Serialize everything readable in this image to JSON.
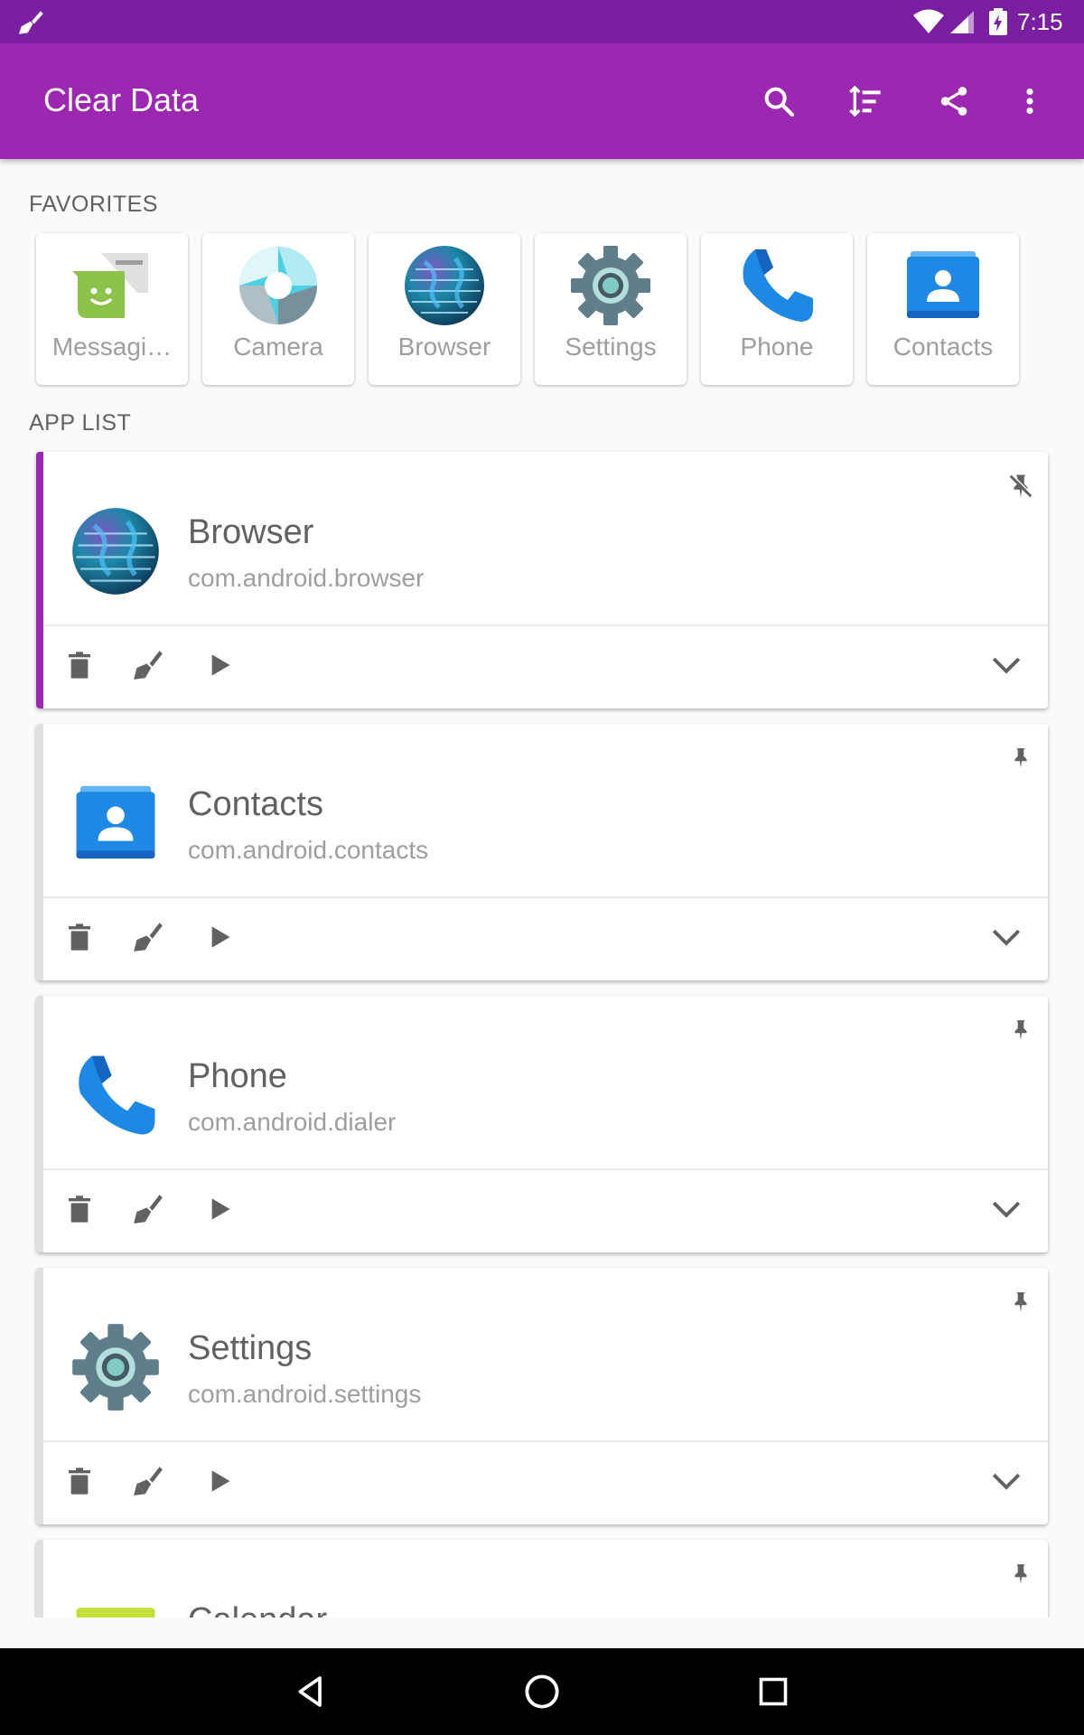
{
  "status_bar": {
    "time": "7:15"
  },
  "app_bar": {
    "title": "Clear Data",
    "icons": [
      "search-icon",
      "sort-icon",
      "share-icon",
      "more-vert-icon"
    ]
  },
  "favorites": {
    "header": "FAVORITES",
    "items": [
      {
        "label": "Messagi…",
        "icon": "messaging-app-icon"
      },
      {
        "label": "Camera",
        "icon": "camera-app-icon"
      },
      {
        "label": "Browser",
        "icon": "browser-app-icon"
      },
      {
        "label": "Settings",
        "icon": "settings-app-icon"
      },
      {
        "label": "Phone",
        "icon": "phone-app-icon"
      },
      {
        "label": "Contacts",
        "icon": "contacts-app-icon"
      }
    ]
  },
  "app_list": {
    "header": "APP LIST",
    "items": [
      {
        "name": "Browser",
        "package": "com.android.browser",
        "pinned": false,
        "active": true
      },
      {
        "name": "Contacts",
        "package": "com.android.contacts",
        "pinned": true,
        "active": false
      },
      {
        "name": "Phone",
        "package": "com.android.dialer",
        "pinned": true,
        "active": false
      },
      {
        "name": "Settings",
        "package": "com.android.settings",
        "pinned": true,
        "active": false
      },
      {
        "name": "Calendar",
        "package": "",
        "pinned": true,
        "active": false
      }
    ],
    "actions": [
      "delete-icon",
      "broom-clear-icon",
      "launch-play-icon",
      "expand-chevron-icon"
    ]
  },
  "colors": {
    "status_bar": "#7b1fa2",
    "app_bar": "#9c27b0",
    "accent_active": "#9c27b0",
    "icon_gray": "#616161"
  }
}
